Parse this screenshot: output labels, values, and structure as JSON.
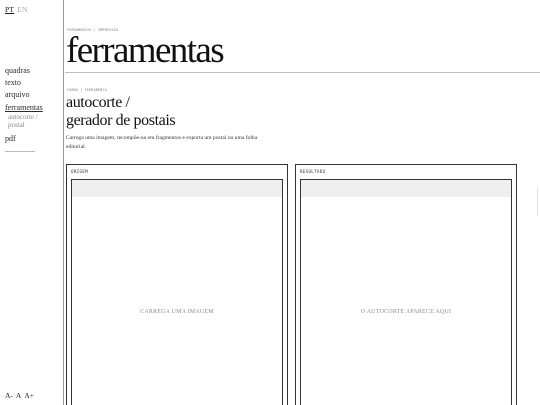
{
  "lang": {
    "pt": "PT",
    "en": "EN"
  },
  "nav": {
    "items": [
      "quadras",
      "texto",
      "arquivo",
      "ferramentas"
    ],
    "sub_items": [
      "autocorte /",
      "postal"
    ],
    "after": "pdf"
  },
  "font_size": {
    "small": "A-",
    "normal": "A",
    "large": "A+"
  },
  "main": {
    "breadcrumb": "FERRAMENTAS / IMPRESSÃO",
    "title": "ferramentas",
    "section_crumb": "FORMA / FERRAMENTA",
    "tool_title_line1": "autocorte /",
    "tool_title_line2": "gerador de postais",
    "description": "Carrega uma imagem, recompõe-na em fragmentos e exporta um postal ou uma folha editorial."
  },
  "panels": {
    "origin": {
      "label": "ORIGEM",
      "hint": "CARREGA UMA IMAGEM"
    },
    "result": {
      "label": "RESULTADO",
      "hint": "O AUTOCORTE APARECE AQUI"
    }
  }
}
